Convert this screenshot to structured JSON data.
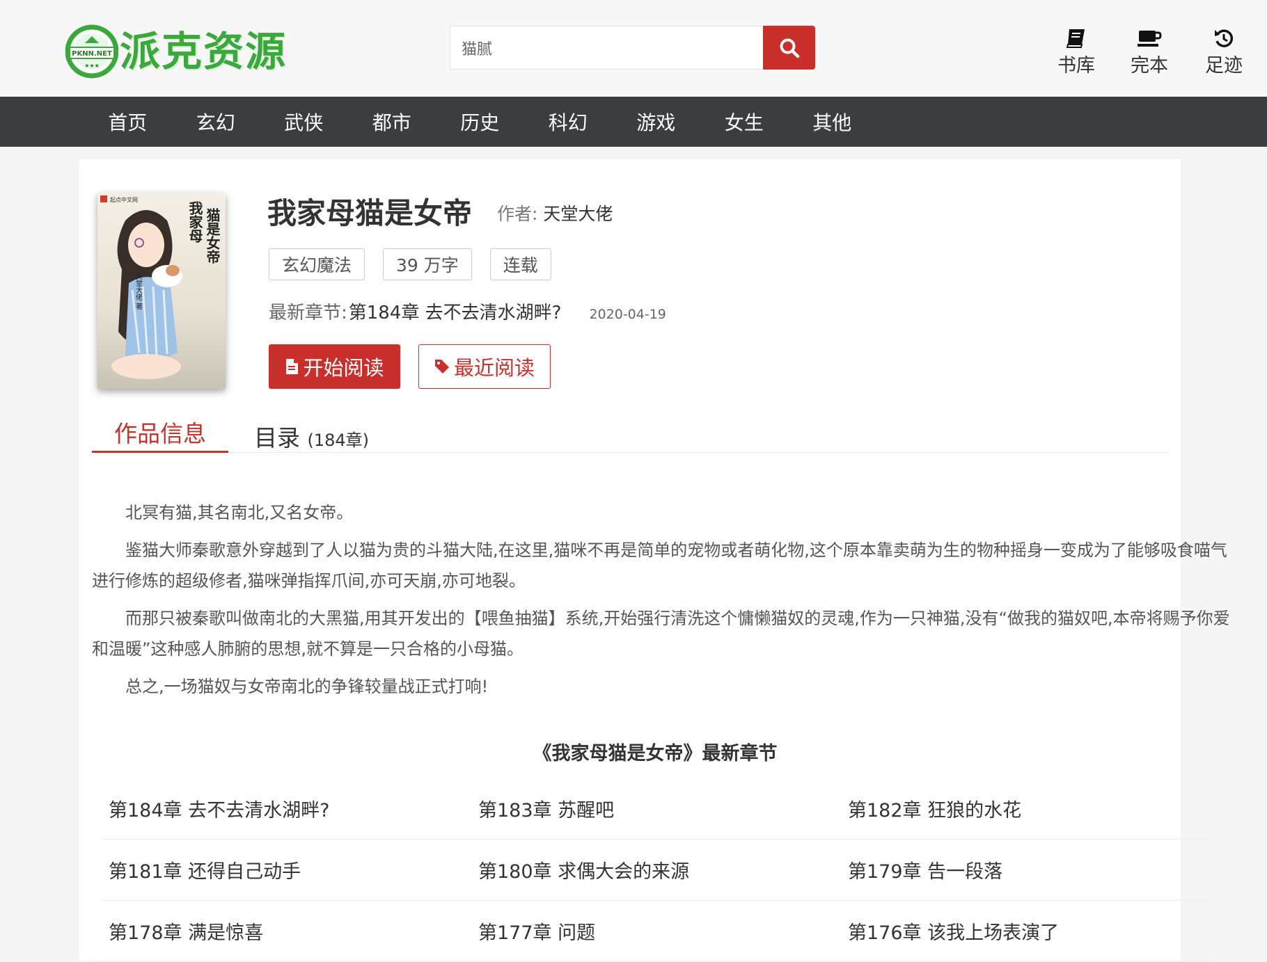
{
  "header": {
    "logo_badge_text": "PKNN.NET",
    "logo_text": "派克资源",
    "search_value": "猫腻",
    "nav_icons": [
      {
        "label": "书库",
        "icon": "book-icon"
      },
      {
        "label": "完本",
        "icon": "coffee-cup-icon"
      },
      {
        "label": "足迹",
        "icon": "history-icon"
      }
    ]
  },
  "navbar": [
    "首页",
    "玄幻",
    "武侠",
    "都市",
    "历史",
    "科幻",
    "游戏",
    "女生",
    "其他"
  ],
  "book": {
    "title": "我家母猫是女帝",
    "author_label": "作者:",
    "author": "天堂大佬",
    "tags": [
      "玄幻魔法",
      "39 万字",
      "连载"
    ],
    "latest_label": "最新章节:",
    "latest_chapter": "第184章 去不去清水湖畔?",
    "latest_date": "2020-04-19",
    "btn_read": "开始阅读",
    "btn_recent": "最近阅读",
    "cover_text": [
      "猫是女帝",
      "我家母",
      "天堂大佬 著"
    ],
    "cover_publisher": "起点中文网"
  },
  "tabs": {
    "info": "作品信息",
    "toc": "目录",
    "toc_count": "(184章)"
  },
  "intro": [
    "北冥有猫,其名南北,又名女帝。",
    "鉴猫大师秦歌意外穿越到了人以猫为贵的斗猫大陆,在这里,猫咪不再是简单的宠物或者萌化物,这个原本靠卖萌为生的物种摇身一变成为了能够吸食喵气进行修炼的超级修者,猫咪弹指挥爪间,亦可天崩,亦可地裂。",
    "而那只被秦歌叫做南北的大黑猫,用其开发出的【喂鱼抽猫】系统,开始强行清洗这个慵懒猫奴的灵魂,作为一只神猫,没有“做我的猫奴吧,本帝将赐予你爱和温暖”这种感人肺腑的思想,就不算是一只合格的小母猫。",
    "总之,一场猫奴与女帝南北的争锋较量战正式打响!"
  ],
  "latest_section_title": "《我家母猫是女帝》最新章节",
  "chapters": [
    [
      "第184章 去不去清水湖畔?",
      "第183章 苏醒吧",
      "第182章 狂狼的水花"
    ],
    [
      "第181章 还得自己动手",
      "第180章 求偶大会的来源",
      "第179章 告一段落"
    ],
    [
      "第178章 满是惊喜",
      "第177章 问题",
      "第176章 该我上场表演了"
    ]
  ],
  "colors": {
    "accent_red": "#c9302c",
    "nav_bg": "#3c3d40",
    "logo_green": "#3aa83a"
  }
}
